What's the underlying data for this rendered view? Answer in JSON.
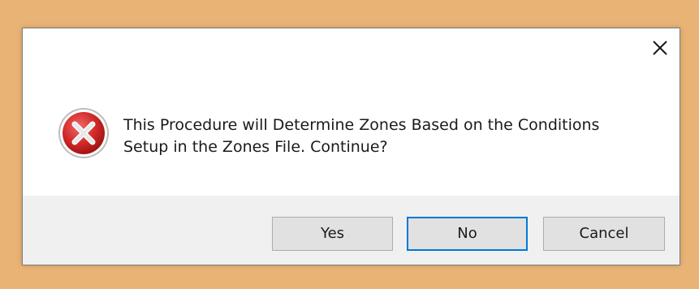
{
  "dialog": {
    "close_icon": "close-icon",
    "icon": "error-icon",
    "message_line1": "This Procedure will Determine Zones Based on the Conditions",
    "message_line2": "Setup in the Zones File.  Continue?",
    "buttons": {
      "yes": "Yes",
      "no": "No",
      "cancel": "Cancel"
    },
    "default_button": "no"
  },
  "colors": {
    "background": "#e9b376",
    "footer": "#f0f0f0",
    "button": "#e1e1e1",
    "default_border": "#0078d7",
    "icon_red": "#d22a2a"
  }
}
